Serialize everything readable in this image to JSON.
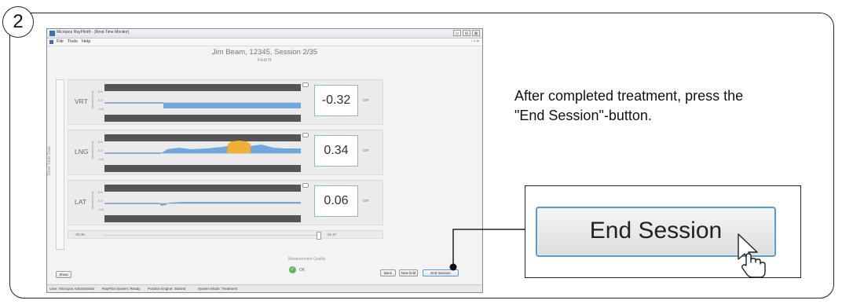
{
  "step_number": "2",
  "window": {
    "title": "Micropos RayPilot® - [Real-Time Monitor]",
    "controls": [
      "▭",
      "⊟",
      "⊠"
    ],
    "menu": [
      "File",
      "Tools",
      "Help"
    ],
    "menu_controls": "- ▫ ×",
    "patient_session": "Jim Beam, 12345, Session 2/35",
    "field_label": "Field f1",
    "side_tab": "Show Table Data",
    "panels": [
      {
        "axis": "VRT",
        "unit": "Deviation [cm]",
        "ticks": [
          "0.5",
          "0.0",
          "-0.5"
        ],
        "value": "-0.32",
        "unit_label": "cm"
      },
      {
        "axis": "LNG",
        "unit": "Deviation [cm]",
        "ticks": [
          "0.5",
          "0.0",
          "-0.5"
        ],
        "value": "0.34",
        "unit_label": "cm"
      },
      {
        "axis": "LAT",
        "unit": "Deviation [cm]",
        "ticks": [
          "0.5",
          "0.0",
          "-0.5"
        ],
        "value": "0.06",
        "unit_label": "cm"
      }
    ],
    "timeline": {
      "start": "-00:30",
      "end": "01:47"
    },
    "measurement_quality": {
      "label": "Measurement Quality",
      "status": "OK"
    },
    "buttons": {
      "show": "Show",
      "back": "Back",
      "new_field": "New field",
      "end_session": "End Session"
    },
    "status_bar": [
      "User: Micropos Administrator",
      "RayPilot System: Ready",
      "Position Engine: Started",
      "System Mode: Treatment"
    ],
    "colors": {
      "signal": "#6fa8dc",
      "out_of_tolerance": "#f0b132",
      "tolerance_band": "#555555",
      "ok": "#5cb85c",
      "value_border": "#8fb4d8"
    }
  },
  "instruction": {
    "line1": "After completed treatment, press the",
    "line2": "\"End Session\"-button."
  },
  "callout": {
    "button_label": "End Session",
    "cursor_icon": "hand-pointer-icon"
  }
}
